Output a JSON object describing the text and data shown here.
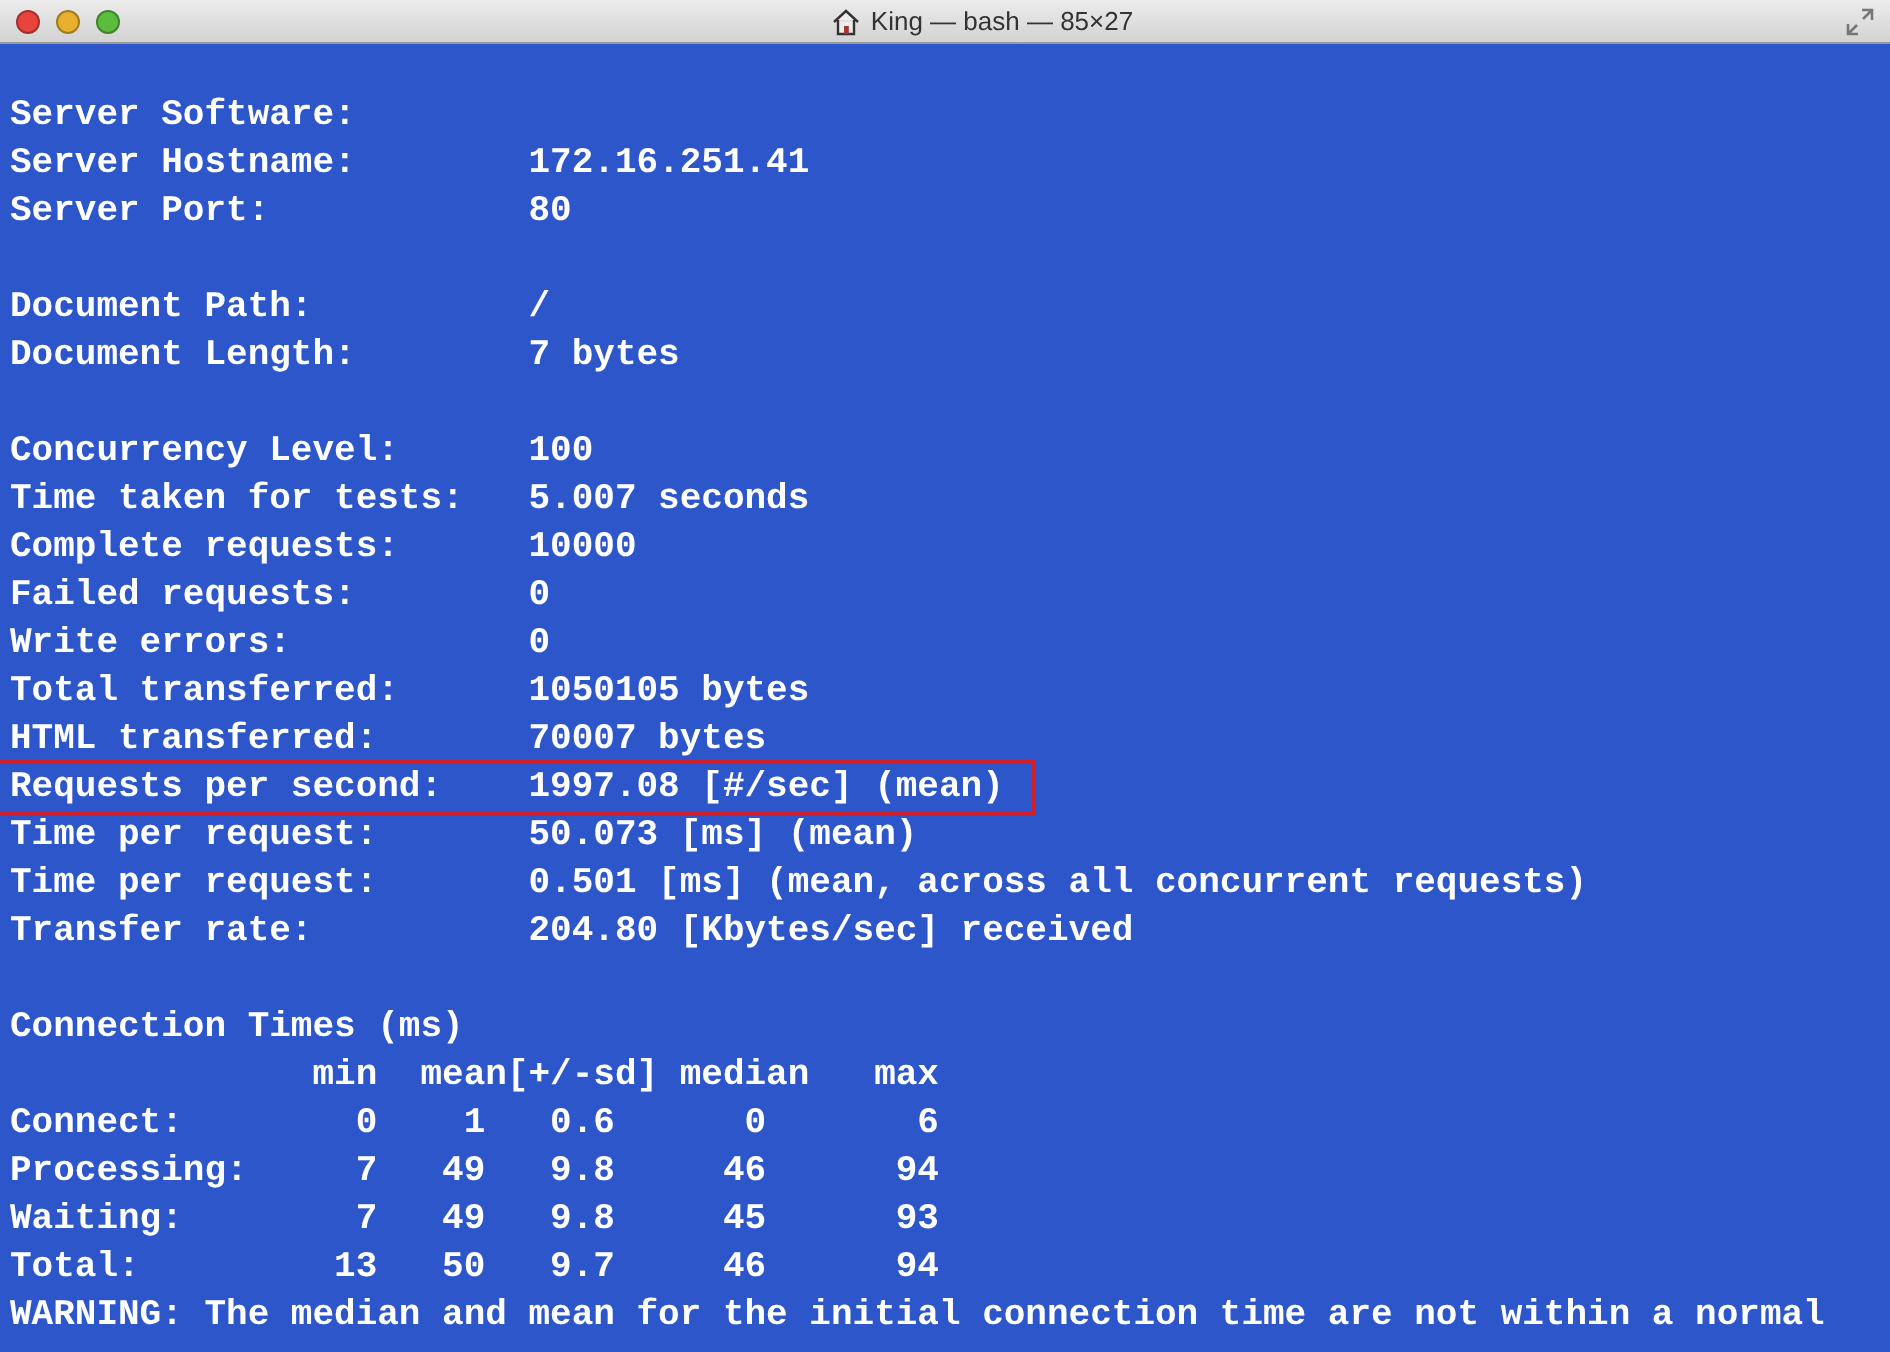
{
  "window": {
    "title": "King — bash — 85×27"
  },
  "blocks": [
    {
      "lines": [
        {
          "text": "Server Software:",
          "highlighted": false
        },
        {
          "text": "Server Hostname:        172.16.251.41",
          "highlighted": false
        },
        {
          "text": "Server Port:            80",
          "highlighted": false
        }
      ]
    },
    {
      "lines": [
        {
          "text": "Document Path:          /",
          "highlighted": false
        },
        {
          "text": "Document Length:        7 bytes",
          "highlighted": false
        }
      ]
    },
    {
      "lines": [
        {
          "text": "Concurrency Level:      100",
          "highlighted": false
        },
        {
          "text": "Time taken for tests:   5.007 seconds",
          "highlighted": false
        },
        {
          "text": "Complete requests:      10000",
          "highlighted": false
        },
        {
          "text": "Failed requests:        0",
          "highlighted": false
        },
        {
          "text": "Write errors:           0",
          "highlighted": false
        },
        {
          "text": "Total transferred:      1050105 bytes",
          "highlighted": false
        },
        {
          "text": "HTML transferred:       70007 bytes",
          "highlighted": false
        },
        {
          "text": "Requests per second:    1997.08 [#/sec] (mean)",
          "highlighted": true
        },
        {
          "text": "Time per request:       50.073 [ms] (mean)",
          "highlighted": false
        },
        {
          "text": "Time per request:       0.501 [ms] (mean, across all concurrent requests)",
          "highlighted": false
        },
        {
          "text": "Transfer rate:          204.80 [Kbytes/sec] received",
          "highlighted": false
        }
      ]
    },
    {
      "lines": [
        {
          "text": "Connection Times (ms)",
          "highlighted": false
        },
        {
          "text": "              min  mean[+/-sd] median   max",
          "highlighted": false
        },
        {
          "text": "Connect:        0    1   0.6      0       6",
          "highlighted": false
        },
        {
          "text": "Processing:     7   49   9.8     46      94",
          "highlighted": false
        },
        {
          "text": "Waiting:        7   49   9.8     45      93",
          "highlighted": false
        },
        {
          "text": "Total:         13   50   9.7     46      94",
          "highlighted": false
        },
        {
          "text": "WARNING: The median and mean for the initial connection time are not within a normal",
          "highlighted": false
        }
      ]
    }
  ]
}
